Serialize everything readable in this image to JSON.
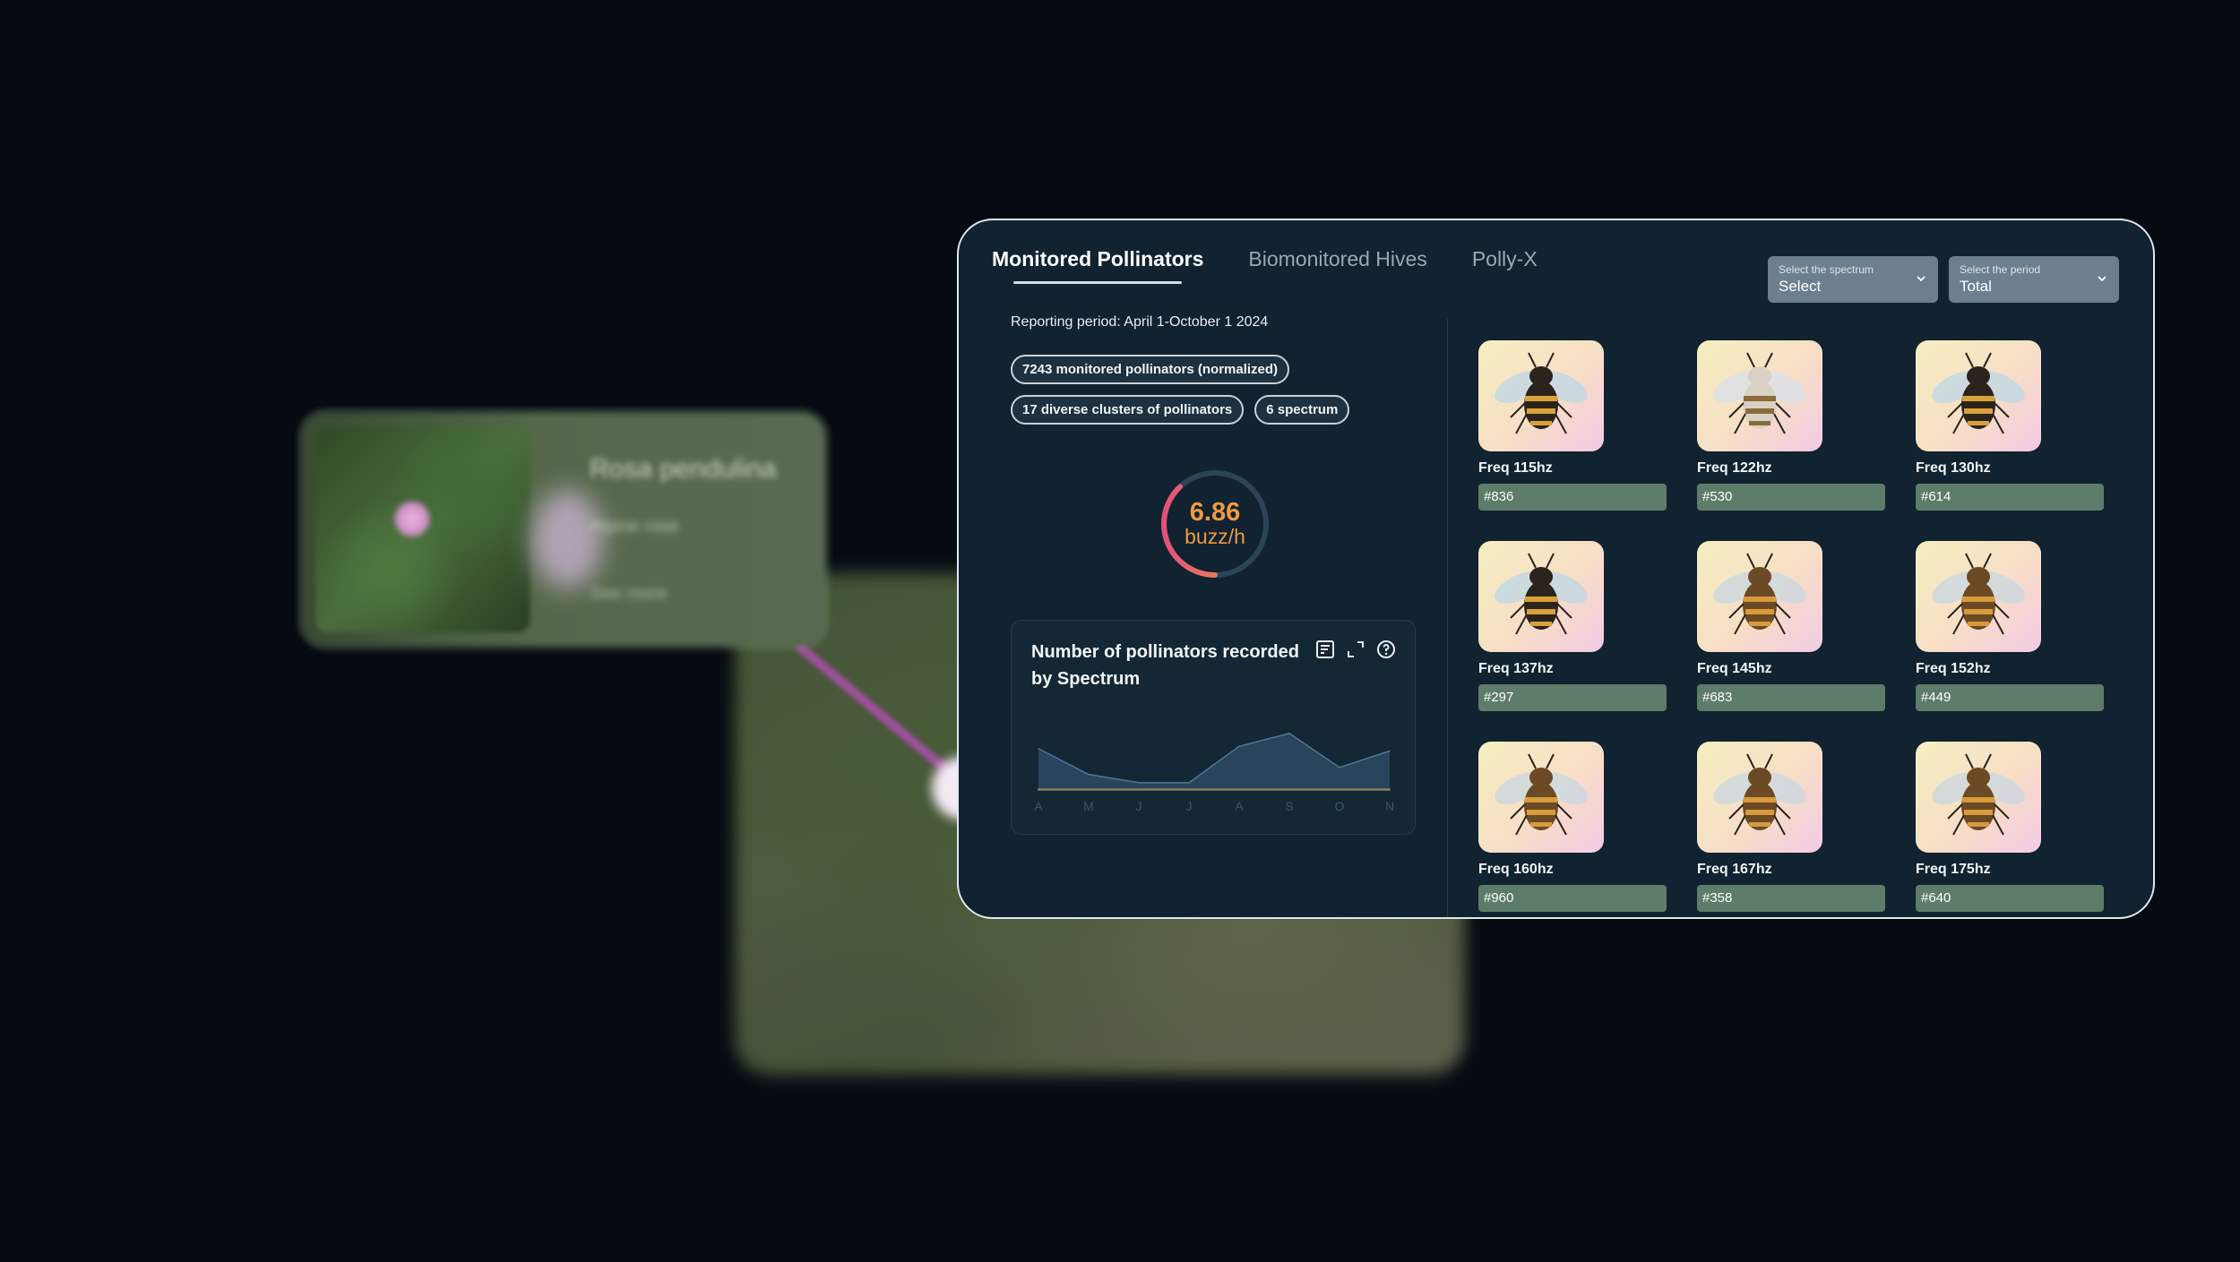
{
  "flower_card": {
    "title": "Rosa pendulina",
    "subtitle": "Alpine rose",
    "footer": "See more"
  },
  "tabs": [
    {
      "label": "Monitored Pollinators",
      "active": true
    },
    {
      "label": "Biomonitored Hives",
      "active": false
    },
    {
      "label": "Polly-X",
      "active": false
    }
  ],
  "filters": {
    "spectrum": {
      "label": "Select the spectrum",
      "value": "Select"
    },
    "period": {
      "label": "Select the period",
      "value": "Total"
    }
  },
  "summary": {
    "period": "Reporting period: April 1-October 1 2024",
    "chips": [
      "7243 monitored pollinators (normalized)",
      "17 diverse clusters of pollinators",
      "6 spectrum"
    ]
  },
  "gauge": {
    "value": "6.86",
    "unit": "buzz/h",
    "fraction": 0.38
  },
  "chart": {
    "title": "Number of pollinators recorded by Spectrum",
    "icons": [
      "note-icon",
      "expand-icon",
      "help-icon"
    ]
  },
  "chart_data": {
    "type": "area",
    "categories": [
      "A",
      "M",
      "J",
      "J",
      "A",
      "S",
      "O",
      "N"
    ],
    "series": [
      {
        "values": [
          36,
          14,
          7,
          7,
          38,
          49,
          20,
          34
        ],
        "color": "#2d4a62"
      },
      {
        "values": [
          1.5,
          1.5,
          1.5,
          1.5,
          1.5,
          1.5,
          1.5,
          1.5
        ],
        "color": "#c96a4a"
      },
      {
        "values": [
          0.8,
          0.8,
          0.8,
          0.8,
          0.8,
          0.8,
          0.8,
          0.8
        ],
        "color": "#5aa06a"
      }
    ],
    "ylim": [
      0,
      55
    ]
  },
  "pollinators": [
    {
      "freq": "Freq 115hz",
      "id": "#836",
      "variant": "dark"
    },
    {
      "freq": "Freq 122hz",
      "id": "#530",
      "variant": "light"
    },
    {
      "freq": "Freq 130hz",
      "id": "#614",
      "variant": "dark"
    },
    {
      "freq": "Freq 137hz",
      "id": "#297",
      "variant": "dark"
    },
    {
      "freq": "Freq 145hz",
      "id": "#683",
      "variant": "honey"
    },
    {
      "freq": "Freq 152hz",
      "id": "#449",
      "variant": "honey"
    },
    {
      "freq": "Freq 160hz",
      "id": "#960",
      "variant": "honey"
    },
    {
      "freq": "Freq 167hz",
      "id": "#358",
      "variant": "honey"
    },
    {
      "freq": "Freq 175hz",
      "id": "#640",
      "variant": "honey"
    }
  ],
  "colors": {
    "panel_bg": "#112230",
    "accent_orange": "#ef9a43",
    "id_bar": "#5d7c69"
  }
}
